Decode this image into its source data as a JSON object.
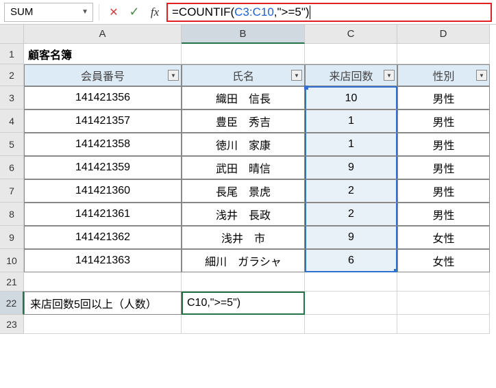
{
  "name_box": "SUM",
  "formula": {
    "prefix": "=COUNTIF(",
    "range": "C3:C10",
    "suffix": ",\">=5\")"
  },
  "columns": [
    "A",
    "B",
    "C",
    "D"
  ],
  "title": "顧客名簿",
  "headers": {
    "member_no": "会員番号",
    "name": "氏名",
    "visits": "来店回数",
    "gender": "性別"
  },
  "rows": [
    {
      "no": "141421356",
      "name": "織田　信長",
      "visits": "10",
      "gender": "男性"
    },
    {
      "no": "141421357",
      "name": "豊臣　秀吉",
      "visits": "1",
      "gender": "男性"
    },
    {
      "no": "141421358",
      "name": "徳川　家康",
      "visits": "1",
      "gender": "男性"
    },
    {
      "no": "141421359",
      "name": "武田　晴信",
      "visits": "9",
      "gender": "男性"
    },
    {
      "no": "141421360",
      "name": "長尾　景虎",
      "visits": "2",
      "gender": "男性"
    },
    {
      "no": "141421361",
      "name": "浅井　長政",
      "visits": "2",
      "gender": "男性"
    },
    {
      "no": "141421362",
      "name": "浅井　市",
      "visits": "9",
      "gender": "女性"
    },
    {
      "no": "141421363",
      "name": "細川　ガラシャ",
      "visits": "6",
      "gender": "女性"
    }
  ],
  "row_labels": [
    "1",
    "2",
    "3",
    "4",
    "5",
    "6",
    "7",
    "8",
    "9",
    "10",
    "21",
    "22",
    "23"
  ],
  "summary": {
    "label": "来店回数5回以上（人数）",
    "editing_display": "C10,\">=5\")"
  },
  "chart_data": {
    "type": "table",
    "title": "顧客名簿",
    "columns": [
      "会員番号",
      "氏名",
      "来店回数",
      "性別"
    ],
    "data": [
      [
        "141421356",
        "織田　信長",
        10,
        "男性"
      ],
      [
        "141421357",
        "豊臣　秀吉",
        1,
        "男性"
      ],
      [
        "141421358",
        "徳川　家康",
        1,
        "男性"
      ],
      [
        "141421359",
        "武田　晴信",
        9,
        "男性"
      ],
      [
        "141421360",
        "長尾　景虎",
        2,
        "男性"
      ],
      [
        "141421361",
        "浅井　長政",
        2,
        "男性"
      ],
      [
        "141421362",
        "浅井　市",
        9,
        "女性"
      ],
      [
        "141421363",
        "細川　ガラシャ",
        6,
        "女性"
      ]
    ]
  }
}
